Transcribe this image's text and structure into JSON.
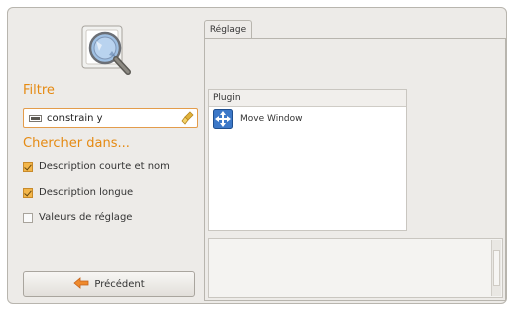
{
  "left": {
    "filter_title": "Filtre",
    "filter_value": "constrain y",
    "search_title": "Chercher dans...",
    "checks": [
      {
        "label": "Description courte et nom",
        "checked": true
      },
      {
        "label": "Description longue",
        "checked": true
      },
      {
        "label": "Valeurs de réglage",
        "checked": false
      }
    ],
    "back_button": "Précédent"
  },
  "right": {
    "tab_label": "Réglage",
    "list_header": "Plugin",
    "plugins": [
      {
        "name": "Move Window",
        "icon": "move-window-icon"
      }
    ]
  },
  "colors": {
    "accent": "#e58a12",
    "window_bg": "#edebe8",
    "border": "#b8b5ae"
  }
}
